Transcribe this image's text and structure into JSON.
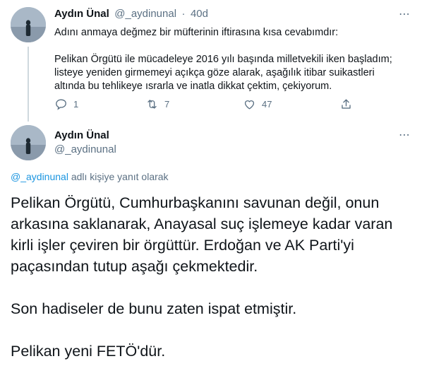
{
  "reply_tweet": {
    "name": "Aydın Ünal",
    "handle": "@_aydinunal",
    "separator": "·",
    "time": "40d",
    "paragraph1": "Adını anmaya değmez bir müfterinin iftirasına kısa cevabımdır:",
    "paragraph2_lines": [
      "Pelikan Örgütü ile mücadeleye 2016 yılı başında milletvekili iken başladım;",
      "listeye yeniden girmemeyi açıkça göze alarak, aşağılık itibar suikastleri",
      "altında bu tehlikeye ısrarla ve inatla dikkat çektim, çekiyorum."
    ],
    "replies": "1",
    "retweets": "7",
    "likes": "47",
    "more_glyph": "⋯"
  },
  "main_tweet": {
    "name": "Aydın Ünal",
    "handle": "@_aydinunal",
    "more_glyph": "⋯",
    "reply_to_handle": "@_aydinunal",
    "reply_to_suffix": " adlı kişiye yanıt olarak",
    "text_lines": [
      "Pelikan Örgütü, Cumhurbaşkanını savunan değil, onun",
      "arkasına saklanarak, Anayasal suç işlemeye kadar varan",
      "kirli işler çeviren bir örgüttür. Erdoğan ve AK Parti'yi",
      "paçasından tutup aşağı çekmektedir.",
      "Son hadiseler de bunu zaten ispat etmiştir.",
      "Pelikan yeni FETÖ'dür."
    ]
  },
  "icons": {
    "reply": "reply-icon",
    "retweet": "retweet-icon",
    "like": "like-icon",
    "share": "share-icon"
  },
  "colors": {
    "link": "#1b95e0",
    "muted": "#5b7083",
    "divider": "#cfd9de"
  }
}
